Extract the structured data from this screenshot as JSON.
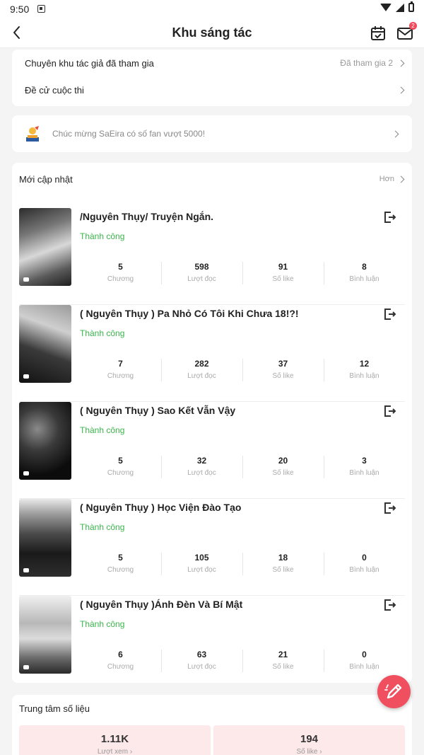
{
  "status_bar": {
    "time": "9:50"
  },
  "header": {
    "title": "Khu sáng tác",
    "mail_badge": "2"
  },
  "top_links": [
    {
      "label": "Chuyên khu tác giả đã tham gia",
      "value": "Đã tham gia 2"
    },
    {
      "label": "Đề cử cuộc thi",
      "value": ""
    }
  ],
  "fan_notice": {
    "text": "Chúc mừng SaEira có số fan vượt 5000!"
  },
  "updates": {
    "title": "Mới cập nhật",
    "more_label": "Hơn",
    "stat_labels": [
      "Chương",
      "Lượt đọc",
      "Số like",
      "Bình luận"
    ],
    "stories": [
      {
        "title": "/Nguyên Thụy/ Truyện Ngắn.",
        "status": "Thành công",
        "chapters": "5",
        "reads": "598",
        "likes": "91",
        "comments": "8"
      },
      {
        "title": "( Nguyên Thụy ) Pa Nhỏ Có Tôi Khi Chưa 18!?!",
        "status": "Thành công",
        "chapters": "7",
        "reads": "282",
        "likes": "37",
        "comments": "12"
      },
      {
        "title": "( Nguyên Thụy ) Sao Kết Vẫn Vậy",
        "status": "Thành công",
        "chapters": "5",
        "reads": "32",
        "likes": "20",
        "comments": "3"
      },
      {
        "title": "( Nguyên Thụy ) Học Viện Đào Tạo",
        "status": "Thành công",
        "chapters": "5",
        "reads": "105",
        "likes": "18",
        "comments": "0"
      },
      {
        "title": "( Nguyên Thụy )Ánh Đèn Và Bí Mật",
        "status": "Thành công",
        "chapters": "6",
        "reads": "63",
        "likes": "21",
        "comments": "0"
      }
    ]
  },
  "metrics": {
    "title": "Trung tâm số liệu",
    "views": {
      "value": "1.11K",
      "label": "Lượt xem"
    },
    "likes": {
      "value": "194",
      "label": "Số like"
    }
  },
  "colors": {
    "accent": "#ef4f5f",
    "success": "#3ab54a",
    "metric_bg": "#fde8ea"
  },
  "icons": [
    "back-arrow-icon",
    "calendar-icon",
    "mail-icon",
    "chevron-right-icon",
    "fan-trophy-icon",
    "export-icon",
    "chat-bubble-icon",
    "pencil-icon"
  ]
}
